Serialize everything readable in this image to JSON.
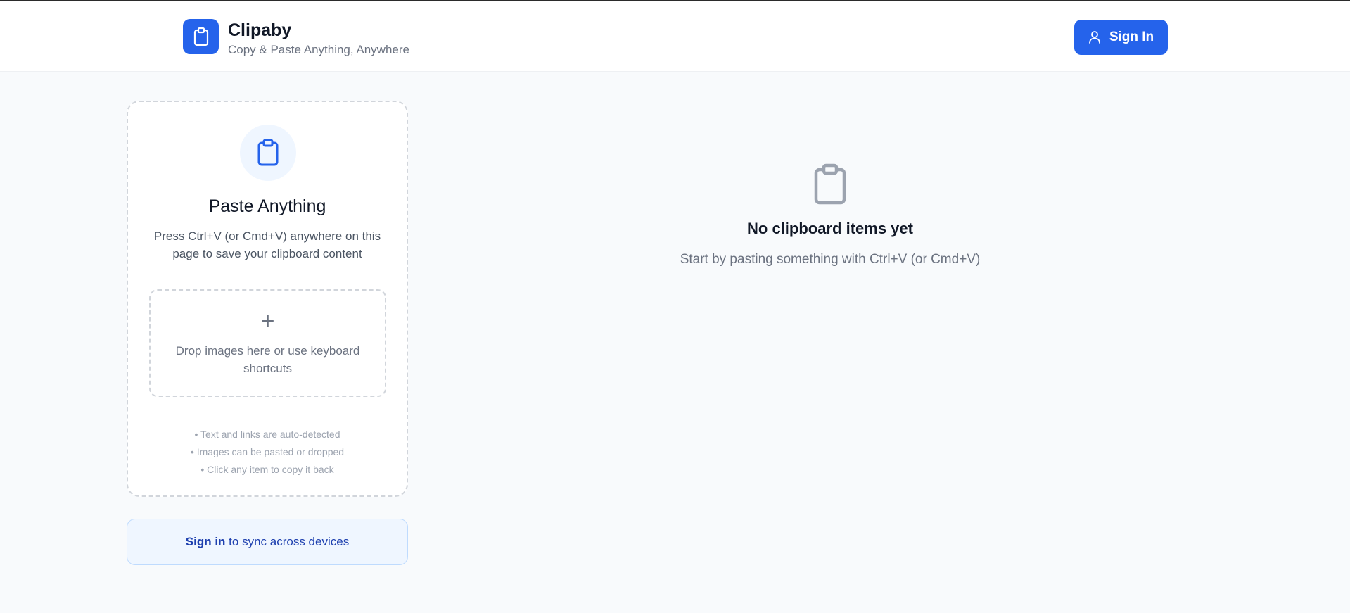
{
  "header": {
    "app_name": "Clipaby",
    "tagline": "Copy & Paste Anything, Anywhere",
    "sign_in_label": "Sign In"
  },
  "paste_card": {
    "title": "Paste Anything",
    "description": "Press Ctrl+V (or Cmd+V) anywhere on this page to save your clipboard content",
    "drop_icon": "+",
    "drop_text": "Drop images here or use keyboard shortcuts",
    "tips": [
      "• Text and links are auto-detected",
      "• Images can be pasted or dropped",
      "• Click any item to copy it back"
    ]
  },
  "sync_box": {
    "link_label": "Sign in",
    "rest_text": " to sync across devices"
  },
  "empty_state": {
    "title": "No clipboard items yet",
    "subtitle": "Start by pasting something with Ctrl+V (or Cmd+V)"
  },
  "colors": {
    "primary": "#2563eb",
    "background": "#f8fafc",
    "muted_text": "#6b7280",
    "sync_bg": "#eff6ff"
  },
  "icons": {
    "logo": "clipboard-icon",
    "sign_in": "user-icon",
    "paste": "clipboard-icon",
    "empty": "clipboard-icon"
  }
}
